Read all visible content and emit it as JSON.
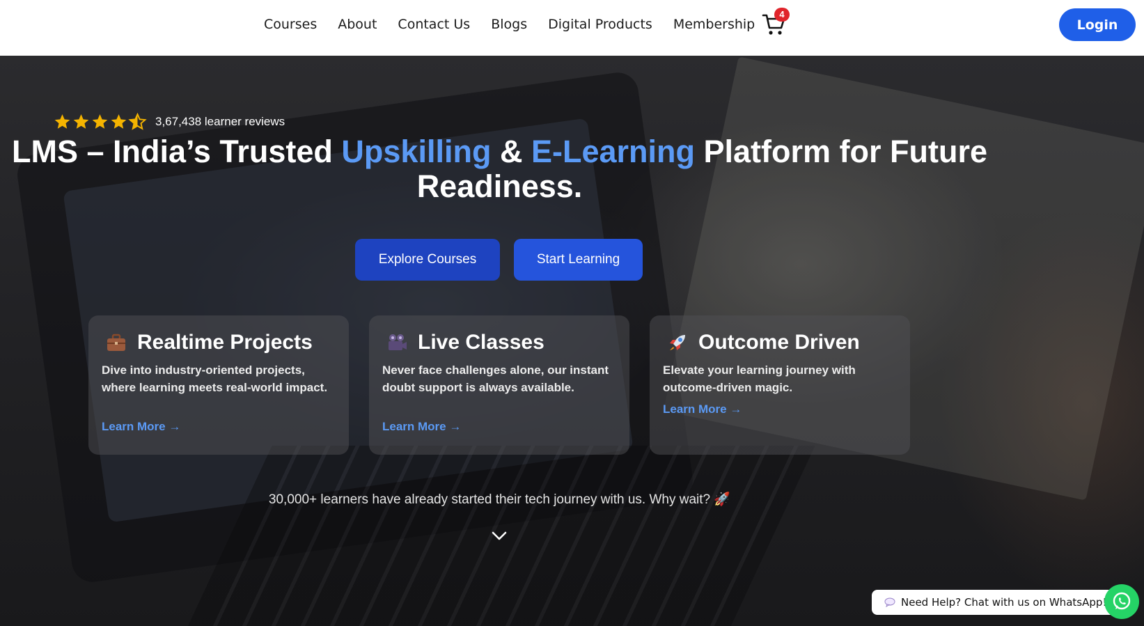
{
  "nav": {
    "links": [
      "Courses",
      "About",
      "Contact Us",
      "Blogs",
      "Digital Products",
      "Membership"
    ],
    "cart_count": "4",
    "cart_icon": "cart-icon",
    "login_label": "Login"
  },
  "hero": {
    "rating": {
      "stars": 4.5,
      "text": "3,67,438 learner reviews"
    },
    "headline": {
      "part1": "LMS – India’s Trusted ",
      "accent1": "Upskilling",
      "part2": " & ",
      "accent2": "E-Learning",
      "part3": " Platform for Future Readiness."
    },
    "buttons": {
      "explore": "Explore Courses",
      "start": "Start Learning"
    },
    "cards": [
      {
        "icon": "briefcase-icon",
        "title": "Realtime Projects",
        "text": "Dive into industry-oriented projects, where learning meets real-world impact.",
        "link": "Learn More →"
      },
      {
        "icon": "video-camera-icon",
        "title": "Live Classes",
        "text": "Never face challenges alone, our instant doubt support is always available.",
        "link": "Learn More →"
      },
      {
        "icon": "rocket-icon",
        "title": "Outcome Driven",
        "text": "Elevate your learning journey with outcome-driven magic.",
        "link": "Learn More →"
      }
    ],
    "tagline": "30,000+ learners have already started their tech journey with us. Why wait? 🚀"
  },
  "help": {
    "text": "Need Help? Chat with us on WhatsApp!",
    "icon": "whatsapp-icon"
  },
  "colors": {
    "accent_blue": "#5b9af5",
    "login_blue": "#1f5fe8",
    "explore_btn": "#1e43c0",
    "start_btn": "#2554dc",
    "star_gold": "#f5b400",
    "badge_red": "#e0242b",
    "whatsapp_green": "#25d366"
  }
}
